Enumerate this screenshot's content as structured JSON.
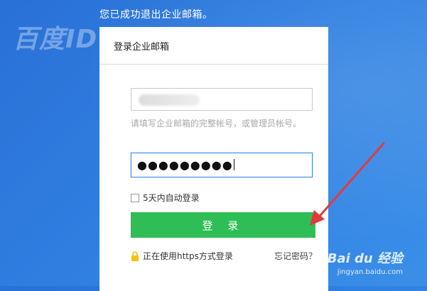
{
  "page": {
    "logout_message": "您已成功退出企业邮箱。",
    "watermark_text": "百度ID guozi"
  },
  "login_card": {
    "title": "登录企业邮箱",
    "username_hint": "请填写企业邮箱的完整帐号，或管理员帐号。",
    "password_mask": "●●●●●●●●●",
    "remember_label": "5天内自动登录",
    "login_button": "登 录",
    "https_note": "正在使用https方式登录",
    "forgot_password": "忘记密码？"
  },
  "colors": {
    "background": "#2f7ee0",
    "login_button": "#2fbd55",
    "annotation_arrow": "#e03b3b",
    "focus_border": "#3d8ae0"
  },
  "icons": {
    "lock": "lock-icon",
    "arrow": "annotation-arrow"
  },
  "baidu_watermark": {
    "brand": "Bai du 经验",
    "url": "jingyan.baidu.com"
  }
}
